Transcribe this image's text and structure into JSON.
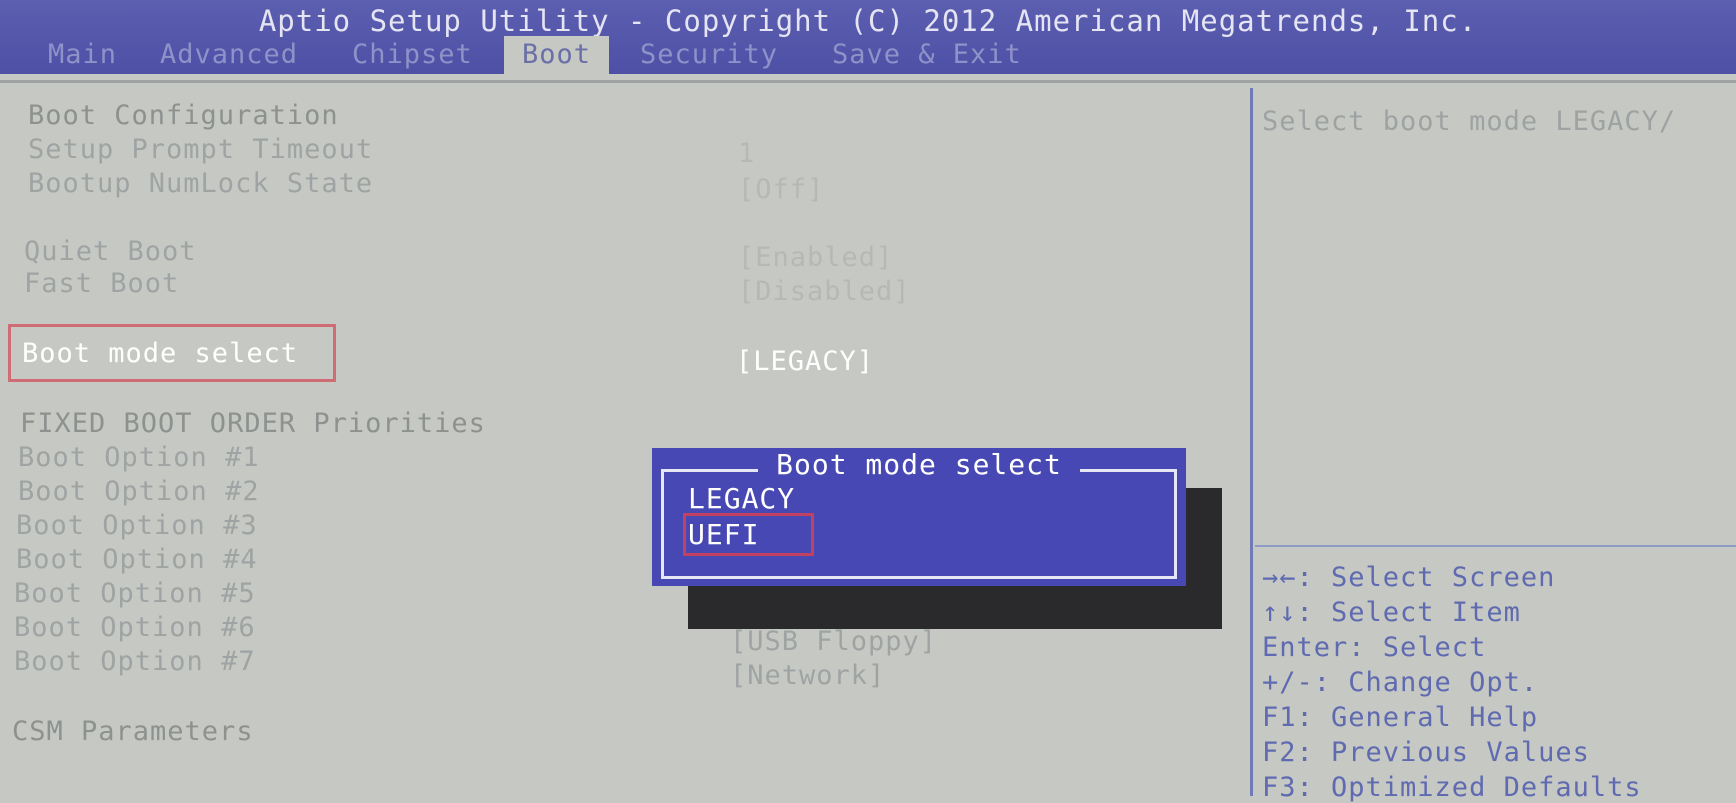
{
  "header": {
    "title": "Aptio Setup Utility - Copyright (C) 2012 American Megatrends, Inc.",
    "tabs": [
      "Main",
      "Advanced",
      "Chipset",
      "Boot",
      "Security",
      "Save & Exit"
    ],
    "active_tab": "Boot"
  },
  "settings": {
    "boot_configuration": "Boot Configuration",
    "setup_prompt_timeout": {
      "label": "Setup Prompt Timeout",
      "value": "1"
    },
    "bootup_numlock_state": {
      "label": "Bootup NumLock State",
      "value": "[Off]"
    },
    "quiet_boot": {
      "label": "Quiet Boot",
      "value": "[Enabled]"
    },
    "fast_boot": {
      "label": "Fast Boot",
      "value": "[Disabled]"
    },
    "boot_mode_select": {
      "label": "Boot mode select",
      "value": "[LEGACY]"
    },
    "fixed_boot_order": "FIXED BOOT ORDER Priorities",
    "boot_options": [
      {
        "label": "Boot Option #1",
        "value": ""
      },
      {
        "label": "Boot Option #2",
        "value": ""
      },
      {
        "label": "Boot Option #3",
        "value": ""
      },
      {
        "label": "Boot Option #4",
        "value": ""
      },
      {
        "label": "Boot Option #5",
        "value": ""
      },
      {
        "label": "Boot Option #6",
        "value": "[USB Floppy]"
      },
      {
        "label": "Boot Option #7",
        "value": "[Network]"
      }
    ],
    "csm_parameters": "CSM Parameters"
  },
  "popup": {
    "title": "Boot mode select",
    "options": [
      "LEGACY",
      "UEFI"
    ],
    "highlighted": "UEFI"
  },
  "help": {
    "description": "Select boot mode LEGACY/",
    "keys": [
      "→←: Select Screen",
      "↑↓: Select Item",
      "Enter: Select",
      "+/-: Change Opt.",
      "F1: General Help",
      "F2: Previous Values",
      "F3: Optimized Defaults"
    ]
  },
  "colors": {
    "header_bg": "#4e50a6",
    "page_bg": "#c6c9c3",
    "popup_bg": "#4848b4",
    "highlight_box": "#d06d74"
  }
}
